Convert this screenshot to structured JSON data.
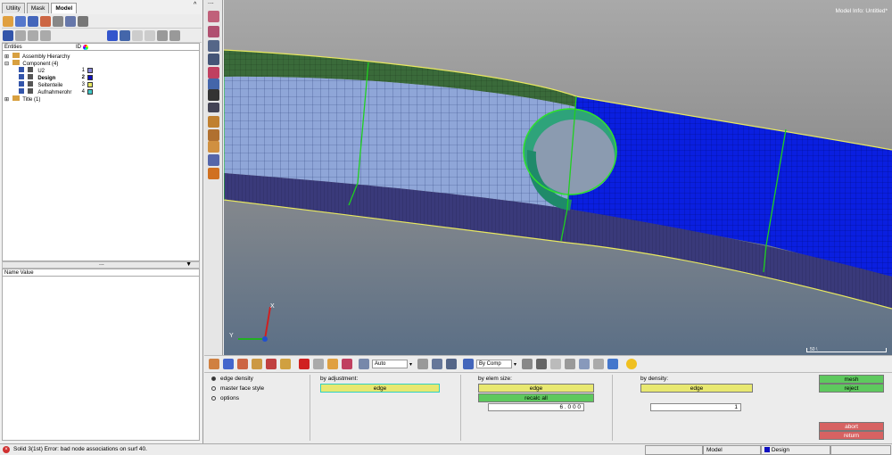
{
  "tabs": [
    "Utility",
    "Mask",
    "Model"
  ],
  "entities": {
    "header_label": "Entities",
    "id_header": "ID",
    "items": [
      {
        "label": "Assembly Hierarchy"
      },
      {
        "label": "Component (4)"
      },
      {
        "label": "U2",
        "id": "1",
        "color": "#8888dd"
      },
      {
        "label": "Design",
        "id": "2",
        "color": "#1010c0"
      },
      {
        "label": "Seitenteile",
        "id": "3",
        "color": "#e8e860"
      },
      {
        "label": "Aufnahmerohr",
        "id": "4",
        "color": "#40c8c8"
      },
      {
        "label": "Title (1)"
      }
    ]
  },
  "name_value_header": "Name Value",
  "viewport": {
    "model_info": "Model Info: Untitled*",
    "axis_x": "X",
    "axis_y": "Y",
    "scale_label": "50 \\"
  },
  "toolbar2": {
    "auto_label": "Auto",
    "by_comp_label": "By Comp"
  },
  "panel": {
    "radios": [
      "edge density",
      "master face style",
      "options"
    ],
    "by_adjustment_label": "by adjustment:",
    "by_adjustment_button": "edge",
    "by_elem_size_label": "by elem size:",
    "by_elem_size_button": "edge",
    "recalc_all_button": "recalc all",
    "elem_size_value": "6 . 0 0 0",
    "by_density_label": "by density:",
    "by_density_button": "edge",
    "density_value": "1",
    "mesh_button": "mesh",
    "reject_button": "reject",
    "abort_button": "abort",
    "return_button": "return"
  },
  "status": {
    "message": "Solid 3(1st) Error: bad node associations on surf 40.",
    "cell_model": "Model",
    "cell_design": "Design"
  },
  "colors": {
    "design_blue": "#0a1fe0",
    "mesh_green": "#22b022",
    "accent_yellow": "#e8e870"
  }
}
